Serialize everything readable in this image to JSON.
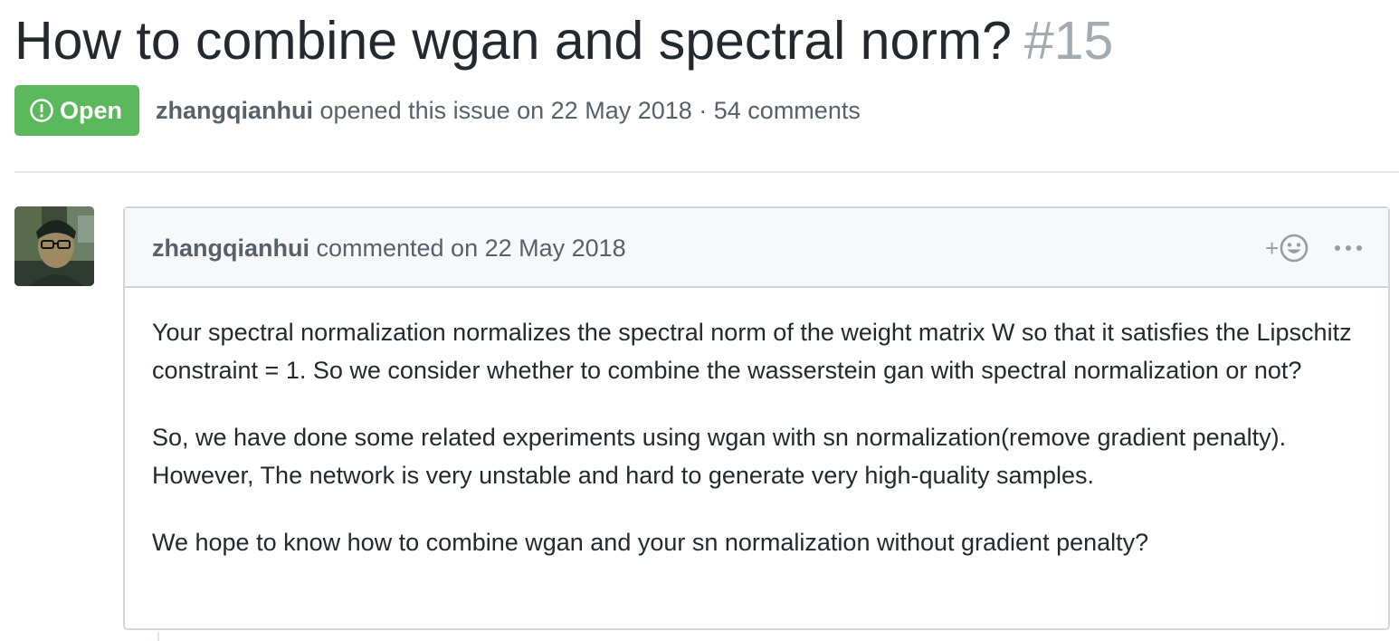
{
  "issue": {
    "title": "How to combine wgan and spectral norm?",
    "number": "#15",
    "state_label": "Open",
    "author": "zhangqianhui",
    "meta_suffix": " opened this issue on 22 May 2018 · 54 comments",
    "state_color": "#5bb85d"
  },
  "comment": {
    "author": "zhangqianhui",
    "action_text": " commented on 22 May 2018",
    "reaction_plus": "+",
    "paragraphs": [
      "Your spectral normalization normalizes the spectral norm of the weight matrix W so that it satisfies the Lipschitz constraint = 1. So we consider whether to combine the wasserstein gan with spectral normalization or not?",
      "So, we have done some related experiments using wgan with sn normalization(remove gradient penalty). However, The network is very unstable and hard to generate very high-quality samples.",
      "We hope to know how to combine wgan and your sn normalization without gradient penalty?"
    ]
  },
  "icons": {
    "state": "issue-opened-icon",
    "reaction": "smiley-icon",
    "more": "kebab-horizontal-icon"
  }
}
